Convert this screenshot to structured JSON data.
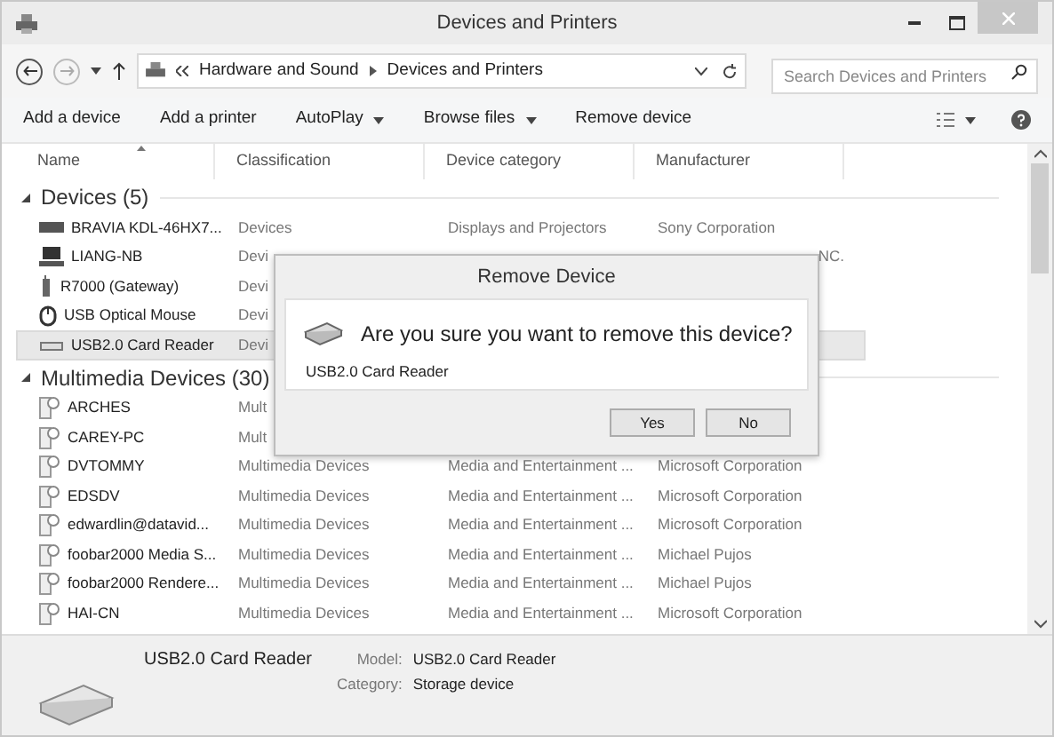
{
  "window": {
    "title": "Devices and Printers"
  },
  "address_bar": {
    "crumbs": [
      "Hardware and Sound",
      "Devices and Printers"
    ]
  },
  "search": {
    "placeholder": "Search Devices and Printers"
  },
  "toolbar": [
    {
      "label": "Add a device",
      "dropdown": false
    },
    {
      "label": "Add a printer",
      "dropdown": false
    },
    {
      "label": "AutoPlay",
      "dropdown": true
    },
    {
      "label": "Browse files",
      "dropdown": true
    },
    {
      "label": "Remove device",
      "dropdown": false
    }
  ],
  "columns": [
    "Name",
    "Classification",
    "Device category",
    "Manufacturer"
  ],
  "groups": [
    {
      "label": "Devices (5)",
      "expanded": true,
      "rows": [
        {
          "kind": "tv",
          "name": "BRAVIA KDL-46HX7...",
          "classification": "Devices",
          "category": "Displays and Projectors",
          "manufacturer": "Sony Corporation",
          "selected": false
        },
        {
          "kind": "computer",
          "name": "LIANG-NB",
          "classification": "Devi",
          "manufacturer": "NC.",
          "manufacturer_cut": true,
          "selected": false
        },
        {
          "kind": "router",
          "name": "R7000 (Gateway)",
          "classification": "Devi",
          "selected": false
        },
        {
          "kind": "mouse",
          "name": "USB Optical Mouse",
          "classification": "Devi",
          "selected": false
        },
        {
          "kind": "card-reader",
          "name": "USB2.0 Card Reader",
          "classification": "Devi",
          "selected": true
        }
      ]
    },
    {
      "label": "Multimedia Devices (30)",
      "expanded": true,
      "rows": [
        {
          "kind": "media",
          "name": "ARCHES",
          "classification": "Mult",
          "selected": false
        },
        {
          "kind": "media",
          "name": "CAREY-PC",
          "classification": "Mult",
          "selected": false
        },
        {
          "kind": "media",
          "name": "DVTOMMY",
          "classification": "Multimedia Devices",
          "category": "Media and Entertainment ...",
          "manufacturer": "Microsoft Corporation",
          "selected": false
        },
        {
          "kind": "media",
          "name": "EDSDV",
          "classification": "Multimedia Devices",
          "category": "Media and Entertainment ...",
          "manufacturer": "Microsoft Corporation",
          "selected": false
        },
        {
          "kind": "media",
          "name": "edwardlin@datavid...",
          "classification": "Multimedia Devices",
          "category": "Media and Entertainment ...",
          "manufacturer": "Microsoft Corporation",
          "selected": false
        },
        {
          "kind": "media",
          "name": "foobar2000 Media S...",
          "classification": "Multimedia Devices",
          "category": "Media and Entertainment ...",
          "manufacturer": "Michael Pujos",
          "selected": false
        },
        {
          "kind": "media",
          "name": "foobar2000 Rendere...",
          "classification": "Multimedia Devices",
          "category": "Media and Entertainment ...",
          "manufacturer": "Michael Pujos",
          "selected": false
        },
        {
          "kind": "media",
          "name": "HAI-CN",
          "classification": "Multimedia Devices",
          "category": "Media and Entertainment ...",
          "manufacturer": "Microsoft Corporation",
          "selected": false
        }
      ]
    }
  ],
  "dialog": {
    "title": "Remove Device",
    "question": "Are you sure you want to remove this device?",
    "device": "USB2.0 Card Reader",
    "buttons": [
      "Yes",
      "No"
    ]
  },
  "details": {
    "name": "USB2.0 Card Reader",
    "fields": [
      {
        "label": "Model:",
        "value": "USB2.0 Card Reader"
      },
      {
        "label": "Category:",
        "value": "Storage device"
      }
    ]
  }
}
